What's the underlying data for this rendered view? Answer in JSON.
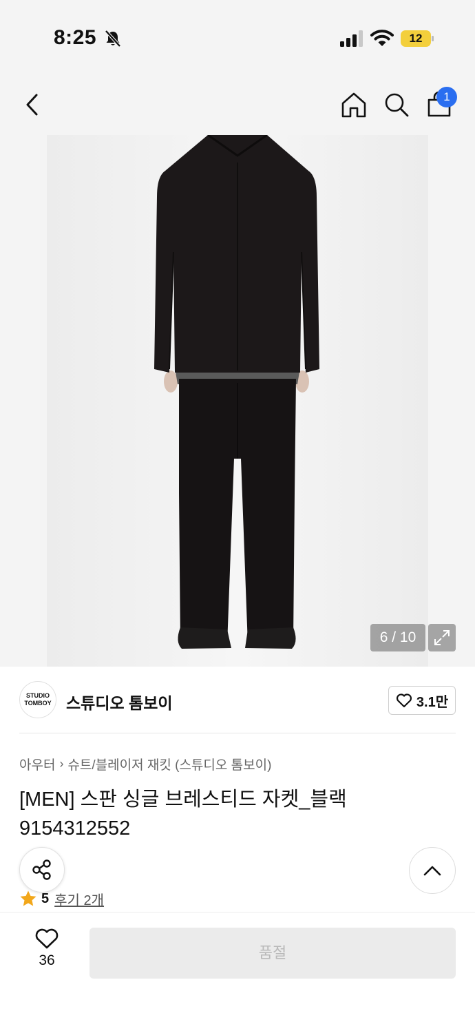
{
  "status_bar": {
    "time": "8:25",
    "battery_level": "12",
    "icons": [
      "bell-slash-icon",
      "cellular-signal-icon",
      "wifi-icon",
      "battery-icon"
    ]
  },
  "nav": {
    "icons": [
      "back-icon",
      "home-icon",
      "search-icon",
      "shopping-bag-icon"
    ],
    "cart_count": "1"
  },
  "gallery": {
    "counter": "6 / 10",
    "icons": [
      "expand-icon"
    ]
  },
  "brand": {
    "logo_line1": "STUDIO",
    "logo_line2": "TOMBOY",
    "name": "스튜디오 톰보이",
    "like_count": "3.1만"
  },
  "breadcrumb": {
    "category": "아우터",
    "subcategory": "슈트/블레이저 재킷 (스튜디오 톰보이)"
  },
  "product": {
    "title": "[MEN] 스판 싱글 브레스티드 자켓_블랙 9154312552"
  },
  "rating": {
    "score": "5",
    "review_link": "후기 2개",
    "star_color": "#f2a71b"
  },
  "bottom_bar": {
    "wish_count": "36",
    "soldout_label": "품절"
  },
  "colors": {
    "badge": "#2a6ef0",
    "soldout_bg": "#ebebeb",
    "soldout_text": "#b9b9b9"
  }
}
